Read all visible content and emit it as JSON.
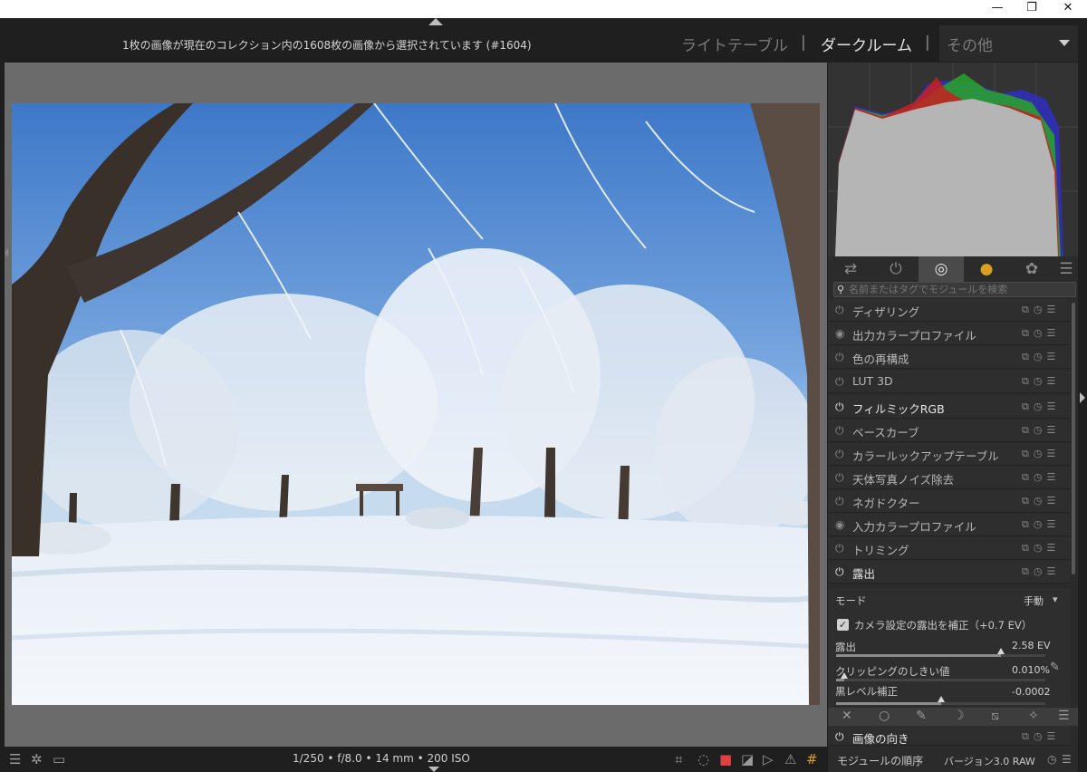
{
  "window": {
    "minimize": "—",
    "maximize": "❐",
    "close": "✕"
  },
  "header": {
    "status": "1枚の画像が現在のコレクション内の1608枚の画像から選択されています (#1604)",
    "tabs": {
      "lighttable": "ライトテーブル",
      "darkroom": "ダークルーム",
      "other": "その他"
    },
    "separator": "|"
  },
  "bottom": {
    "exif": "1/250 • f/8.0 • 14 mm • 200 ISO"
  },
  "panel": {
    "search_placeholder": "名前またはタグでモジュールを検索",
    "modules": [
      {
        "label": "ディザリング",
        "power": "⏻",
        "state": "off"
      },
      {
        "label": "出力カラープロファイル",
        "power": "◉",
        "state": "always"
      },
      {
        "label": "色の再構成",
        "power": "⏻",
        "state": "off"
      },
      {
        "label": "LUT 3D",
        "power": "⏻",
        "state": "off"
      },
      {
        "label": "フィルミックRGB",
        "power": "⏻",
        "state": "on"
      },
      {
        "label": "ベースカーブ",
        "power": "⏻",
        "state": "off"
      },
      {
        "label": "カラールックアップテーブル",
        "power": "⏻",
        "state": "off"
      },
      {
        "label": "天体写真ノイズ除去",
        "power": "⏻",
        "state": "off"
      },
      {
        "label": "ネガドクター",
        "power": "⏻",
        "state": "off"
      },
      {
        "label": "入力カラープロファイル",
        "power": "◉",
        "state": "always"
      },
      {
        "label": "トリミング",
        "power": "⏻",
        "state": "off"
      },
      {
        "label": "露出",
        "power": "⏻",
        "state": "on"
      }
    ],
    "module_actions": "⧉◷☰",
    "exposure": {
      "mode_label": "モード",
      "mode_value": "手動",
      "mode_chevron": "▾",
      "compensate_label": "カメラ設定の露出を補正（+0.7 EV）",
      "exposure_label": "露出",
      "exposure_value": "2.58 EV",
      "exposure_fraction": 0.79,
      "clip_label": "クリッピングのしきい値",
      "clip_value": "0.010%",
      "clip_fraction": 0.04,
      "black_label": "黒レベル補正",
      "black_value": "-0.0002",
      "black_fraction": 0.5,
      "picker_icon": "✎"
    },
    "orientation_label": "画像の向き",
    "footer": {
      "order_label": "モジュールの順序",
      "order_value": "バージョン3.0 RAW"
    }
  }
}
